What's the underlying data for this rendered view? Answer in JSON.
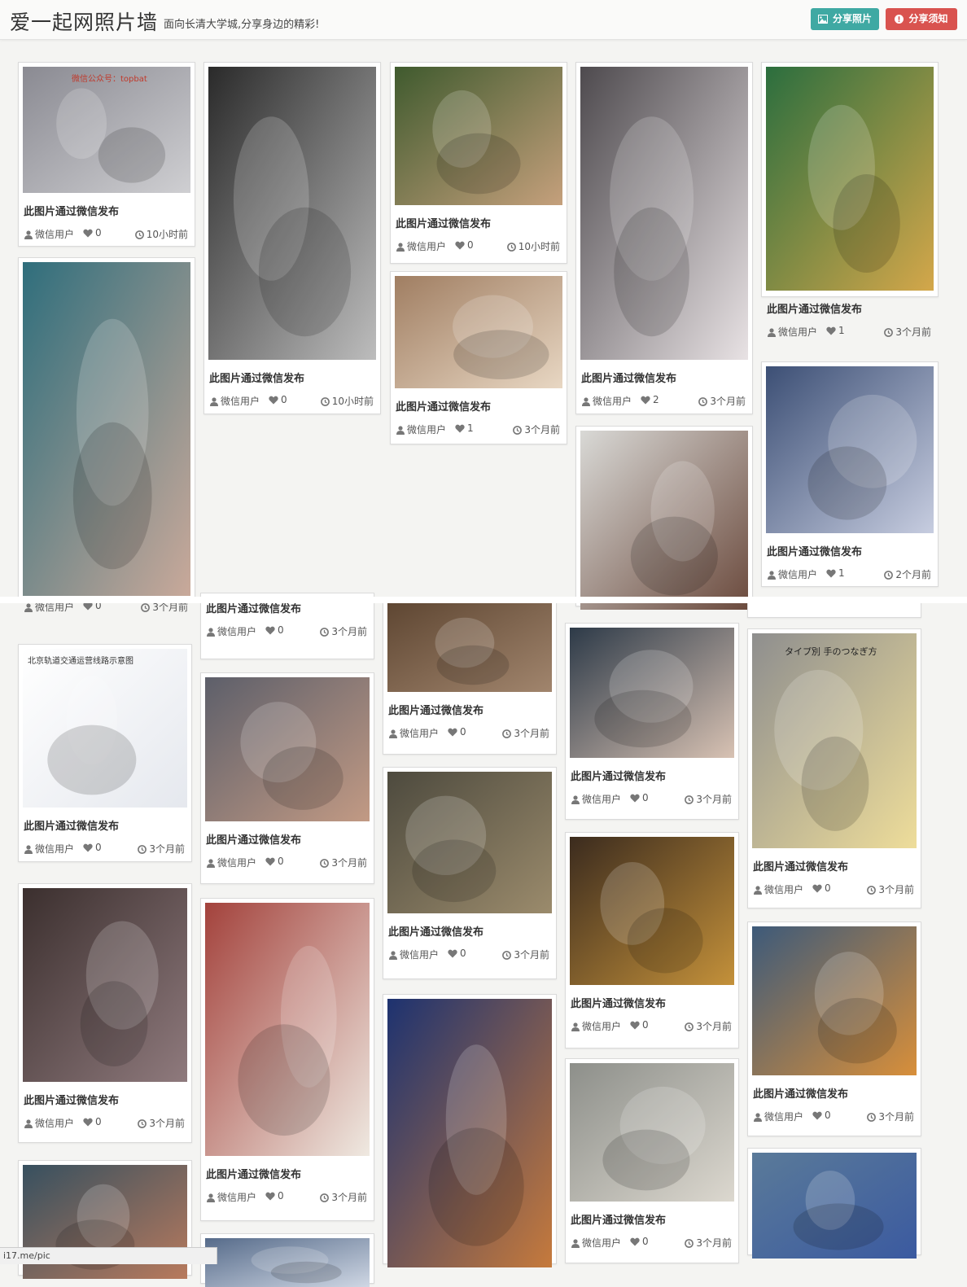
{
  "header": {
    "title": "爱一起网照片墙",
    "subtitle": "面向长清大学城,分享身边的精彩!",
    "share_button": "分享照片",
    "notice_button": "分享须知"
  },
  "status_url": "i17.me/pic",
  "cards": [
    {
      "caption": "此图片通过微信发布",
      "user": "微信用户",
      "likes": "0",
      "time": "10小时前",
      "photo_text": "微信公众号：topbat",
      "colors": [
        "#8a8a92",
        "#cfcfd2"
      ]
    },
    {
      "caption": "",
      "user": "微信用户",
      "likes": "0",
      "time": "3个月前",
      "photo_text": "",
      "colors": [
        "#2f6e7c",
        "#c9a99a"
      ]
    },
    {
      "caption": "此图片通过微信发布",
      "user": "微信用户",
      "likes": "0",
      "time": "3个月前",
      "photo_text": "北京轨道交通运营线路示意图",
      "colors": [
        "#ffffff",
        "#e5e8ee"
      ]
    },
    {
      "caption": "此图片通过微信发布",
      "user": "微信用户",
      "likes": "0",
      "time": "3个月前",
      "photo_text": "",
      "colors": [
        "#3b2f2e",
        "#8f7a7d"
      ]
    },
    {
      "caption": "",
      "user": "",
      "likes": "",
      "time": "",
      "photo_text": "",
      "colors": [
        "#37505f",
        "#b87a5d"
      ]
    },
    {
      "caption": "此图片通过微信发布",
      "user": "微信用户",
      "likes": "0",
      "time": "10小时前",
      "photo_text": "",
      "colors": [
        "#2a2a2a",
        "#bdbdbd"
      ]
    },
    {
      "caption": "此图片通过微信发布",
      "user": "微信用户",
      "likes": "0",
      "time": "3个月前",
      "photo_text": "",
      "colors": [
        "#2c2a28",
        "#8a5b3e"
      ]
    },
    {
      "caption": "此图片通过微信发布",
      "user": "微信用户",
      "likes": "0",
      "time": "3个月前",
      "photo_text": "",
      "colors": [
        "#5d5f6a",
        "#c29a84"
      ]
    },
    {
      "caption": "此图片通过微信发布",
      "user": "微信用户",
      "likes": "0",
      "time": "3个月前",
      "photo_text": "",
      "colors": [
        "#a3423c",
        "#efe9e1"
      ]
    },
    {
      "caption": "",
      "user": "",
      "likes": "",
      "time": "",
      "photo_text": "",
      "colors": [
        "#566b8a",
        "#cfd7e4"
      ]
    },
    {
      "caption": "此图片通过微信发布",
      "user": "微信用户",
      "likes": "0",
      "time": "10小时前",
      "photo_text": "",
      "colors": [
        "#3f5a2e",
        "#c5a07c"
      ]
    },
    {
      "caption": "此图片通过微信发布",
      "user": "微信用户",
      "likes": "1",
      "time": "3个月前",
      "photo_text": "",
      "colors": [
        "#a07e62",
        "#e8d7c3"
      ]
    },
    {
      "caption": "此图片通过微信发布",
      "user": "微信用户",
      "likes": "0",
      "time": "3个月前",
      "photo_text": "",
      "colors": [
        "#5e4632",
        "#a1856d"
      ]
    },
    {
      "caption": "此图片通过微信发布",
      "user": "微信用户",
      "likes": "0",
      "time": "3个月前",
      "photo_text": "",
      "colors": [
        "#4d4a3e",
        "#9b8b6c"
      ]
    },
    {
      "caption": "",
      "user": "",
      "likes": "",
      "time": "",
      "photo_text": "",
      "colors": [
        "#1d3270",
        "#c67a3c"
      ]
    },
    {
      "caption": "此图片通过微信发布",
      "user": "微信用户",
      "likes": "2",
      "time": "3个月前",
      "photo_text": "",
      "colors": [
        "#4e4a4e",
        "#e8e2e4"
      ]
    },
    {
      "caption": "",
      "user": "",
      "likes": "",
      "time": "",
      "photo_text": "",
      "colors": [
        "#d9d9d6",
        "#6b4a3d"
      ]
    },
    {
      "caption": "此图片通过微信发布",
      "user": "微信用户",
      "likes": "0",
      "time": "3个月前",
      "photo_text": "",
      "colors": [
        "#2d3a48",
        "#d8c2b3"
      ]
    },
    {
      "caption": "此图片通过微信发布",
      "user": "微信用户",
      "likes": "0",
      "time": "3个月前",
      "photo_text": "",
      "colors": [
        "#3b2b1e",
        "#c4913a"
      ]
    },
    {
      "caption": "此图片通过微信发布",
      "user": "微信用户",
      "likes": "0",
      "time": "3个月前",
      "photo_text": "",
      "colors": [
        "#8d8f8a",
        "#dcd8cf"
      ]
    },
    {
      "caption": "此图片通过微信发布",
      "user": "微信用户",
      "likes": "1",
      "time": "3个月前",
      "photo_text": "",
      "colors": [
        "#2b6e3e",
        "#d4a74a"
      ]
    },
    {
      "caption": "此图片通过微信发布",
      "user": "微信用户",
      "likes": "1",
      "time": "2个月前",
      "photo_text": "",
      "colors": [
        "#3c4f75",
        "#c7cde0"
      ]
    },
    {
      "caption": "",
      "user": "",
      "likes": "",
      "time": "",
      "photo_text": "",
      "colors": [
        "#ffffff",
        "#ffffff"
      ]
    },
    {
      "caption": "此图片通过微信发布",
      "user": "微信用户",
      "likes": "0",
      "time": "3个月前",
      "photo_text": "タイプ別 手のつなぎ方",
      "colors": [
        "#8e8e8e",
        "#eedd9a"
      ]
    },
    {
      "caption": "此图片通过微信发布",
      "user": "微信用户",
      "likes": "0",
      "time": "3个月前",
      "photo_text": "",
      "colors": [
        "#3d5a7a",
        "#d88f3a"
      ]
    },
    {
      "caption": "",
      "user": "",
      "likes": "",
      "time": "",
      "photo_text": "",
      "colors": [
        "#5a7a99",
        "#3b5aa0"
      ]
    }
  ]
}
